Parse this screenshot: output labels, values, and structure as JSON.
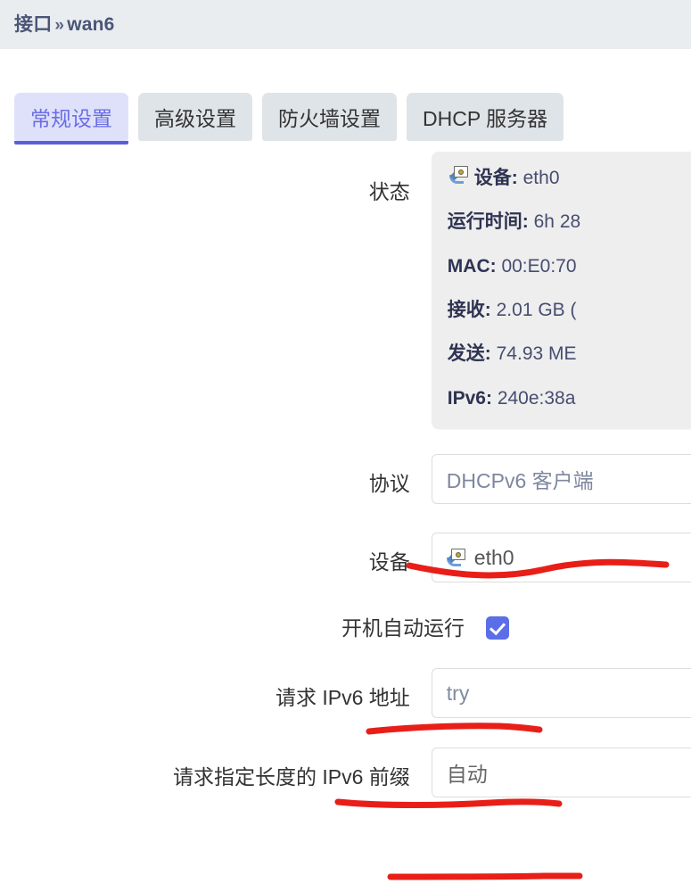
{
  "header": {
    "breadcrumb_root": "接口",
    "breadcrumb_separator": "»",
    "breadcrumb_current": "wan6"
  },
  "tabs": [
    {
      "label": "常规设置",
      "active": true
    },
    {
      "label": "高级设置",
      "active": false
    },
    {
      "label": "防火墙设置",
      "active": false
    },
    {
      "label": "DHCP 服务器",
      "active": false
    }
  ],
  "form": {
    "status": {
      "label": "状态",
      "icon": "network-device-icon",
      "lines": [
        {
          "key": "设备:",
          "value": "eth0"
        },
        {
          "key": "运行时间:",
          "value": "6h 28"
        },
        {
          "key": "MAC:",
          "value": "00:E0:70"
        },
        {
          "key": "接收:",
          "value": "2.01 GB ("
        },
        {
          "key": "发送:",
          "value": "74.93 ME"
        },
        {
          "key": "IPv6:",
          "value": "240e:38a"
        }
      ]
    },
    "protocol": {
      "label": "协议",
      "value": "DHCPv6 客户端"
    },
    "device": {
      "label": "设备",
      "value": "eth0",
      "icon": "network-device-icon"
    },
    "bringup_on_boot": {
      "label": "开机自动运行",
      "checked": true
    },
    "request_ipv6_address": {
      "label": "请求 IPv6 地址",
      "value": "try"
    },
    "request_ipv6_prefix": {
      "label": "请求指定长度的 IPv6 前缀",
      "value": "自动"
    }
  },
  "annotation": {
    "color": "#e81f18",
    "strokes": 4
  }
}
